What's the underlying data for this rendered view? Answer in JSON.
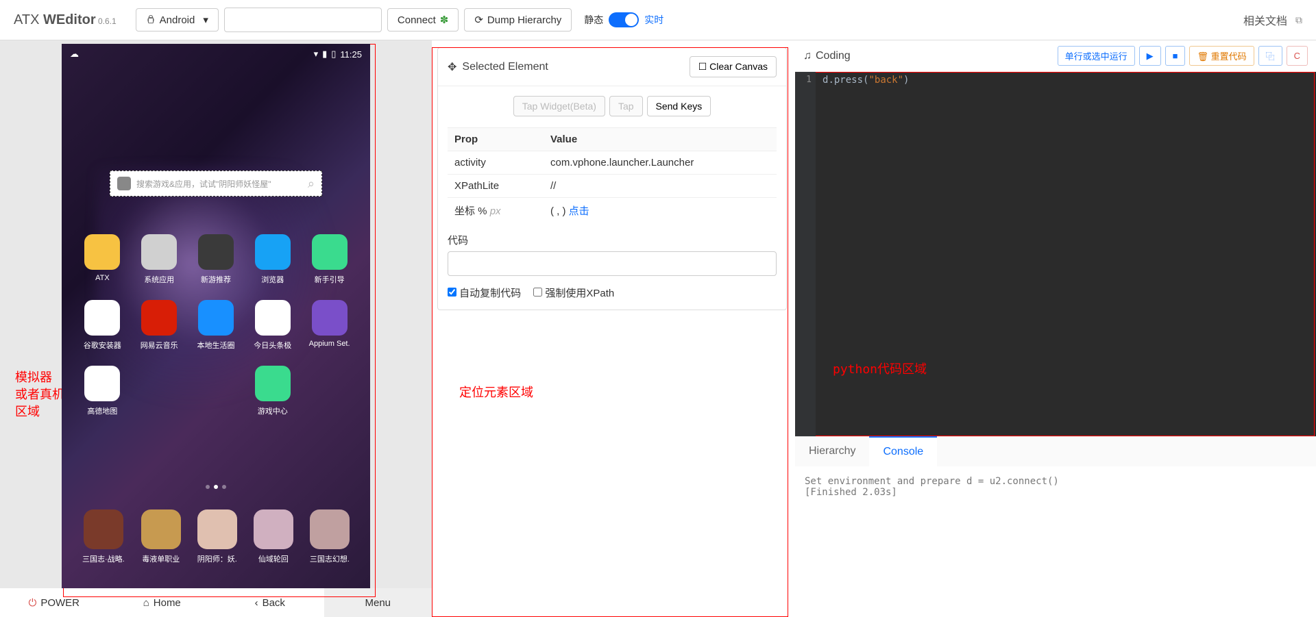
{
  "brand": {
    "name_pre": "ATX ",
    "name_bold": "WEditor",
    "version": " 0.6.1"
  },
  "topbar": {
    "platform": "Android",
    "connect": "Connect",
    "dump": "Dump Hierarchy",
    "static_label": "静态",
    "live_label": "实时",
    "docs": "相关文档"
  },
  "annotations": {
    "left": "模拟器\n或者真机\n区域",
    "mid": "定位元素区域",
    "editor": "python代码区域"
  },
  "phone": {
    "time": "11:25",
    "search_placeholder": "搜索游戏&应用，试试\"阴阳师妖怪屋\"",
    "apps_row1": [
      {
        "label": "ATX",
        "bg": "#f7c242"
      },
      {
        "label": "系统应用",
        "bg": "#d0d0d0"
      },
      {
        "label": "新游推荐",
        "bg": "#3a3a3a"
      },
      {
        "label": "浏览器",
        "bg": "#17a2f5"
      },
      {
        "label": "新手引导",
        "bg": "#3adb8e"
      }
    ],
    "apps_row2": [
      {
        "label": "谷歌安装器",
        "bg": "#ffffff"
      },
      {
        "label": "网易云音乐",
        "bg": "#d81e06"
      },
      {
        "label": "本地生活圈",
        "bg": "#1890ff"
      },
      {
        "label": "今日头条极",
        "bg": "#ffffff"
      },
      {
        "label": "Appium Set.",
        "bg": "#7a4fc9"
      }
    ],
    "apps_row3": [
      {
        "label": "高德地图",
        "bg": "#ffffff"
      },
      {
        "label": "游戏中心",
        "bg": "#3adb8e"
      }
    ],
    "dock": [
      {
        "label": "三国志·战略.",
        "bg": "#7a3a2a"
      },
      {
        "label": "毒液单职业",
        "bg": "#c79a50"
      },
      {
        "label": "阴阳师：妖.",
        "bg": "#e0c0b0"
      },
      {
        "label": "仙域轮回",
        "bg": "#d0b0c0"
      },
      {
        "label": "三国志幻想.",
        "bg": "#c0a0a0"
      }
    ]
  },
  "bottombar": {
    "power": "POWER",
    "home": "Home",
    "back": "Back",
    "menu": "Menu"
  },
  "selected": {
    "title": "Selected Element",
    "clear": "Clear Canvas",
    "tap_widget": "Tap Widget(Beta)",
    "tap": "Tap",
    "send_keys": "Send Keys",
    "prop_header": "Prop",
    "value_header": "Value",
    "rows": [
      {
        "prop": "activity",
        "value": "com.vphone.launcher.Launcher"
      },
      {
        "prop": "XPathLite",
        "value": "//"
      }
    ],
    "coord_label": "坐标 % ",
    "coord_px": "px",
    "coord_value": "( , ) ",
    "coord_click": "点击",
    "code_label": "代码",
    "auto_copy": "自动复制代码",
    "force_xpath": "强制使用XPath"
  },
  "coding": {
    "title": "Coding",
    "run": "单行或选中运行",
    "reset": "重置代码",
    "code_parts": {
      "obj": "d",
      "dot": ".",
      "method": "press",
      "lp": "(",
      "str": "\"back\"",
      "rp": ")"
    }
  },
  "right_tabs": {
    "hierarchy": "Hierarchy",
    "console": "Console"
  },
  "console_text": "Set environment and prepare d = u2.connect()\n[Finished 2.03s]"
}
